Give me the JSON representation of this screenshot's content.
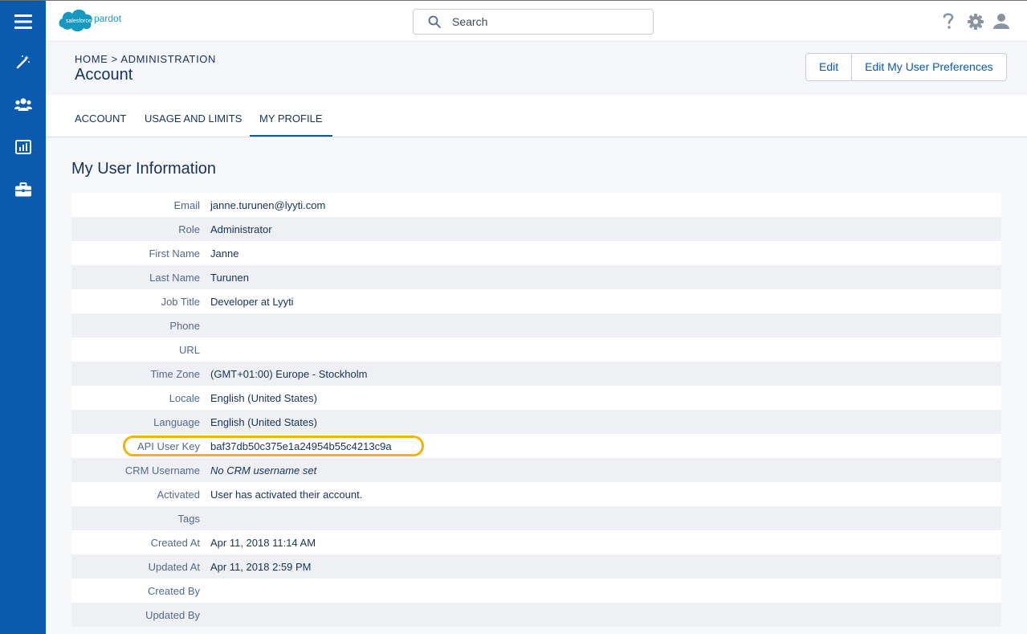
{
  "header": {
    "logo_brand": "salesforce",
    "logo_product": "pardot",
    "search_placeholder": "Search",
    "icons": [
      "help-icon",
      "gear-icon",
      "user-icon"
    ]
  },
  "nav": {
    "icons": [
      "menu-icon",
      "magic-wand-icon",
      "people-icon",
      "chart-icon",
      "briefcase-icon"
    ]
  },
  "breadcrumb": {
    "home": "HOME",
    "separator": ">",
    "admin": "ADMINISTRATION"
  },
  "page_title": "Account",
  "buttons": {
    "edit": "Edit",
    "edit_prefs": "Edit My User Preferences"
  },
  "tabs": [
    {
      "label": "ACCOUNT"
    },
    {
      "label": "USAGE AND LIMITS"
    },
    {
      "label": "MY PROFILE",
      "active": true
    }
  ],
  "section_title": "My User Information",
  "user_info": [
    {
      "label": "Email",
      "value": "janne.turunen@lyyti.com"
    },
    {
      "label": "Role",
      "value": "Administrator"
    },
    {
      "label": "First Name",
      "value": "Janne"
    },
    {
      "label": "Last Name",
      "value": "Turunen"
    },
    {
      "label": "Job Title",
      "value": "Developer at Lyyti"
    },
    {
      "label": "Phone",
      "value": ""
    },
    {
      "label": "URL",
      "value": ""
    },
    {
      "label": "Time Zone",
      "value": "(GMT+01:00) Europe - Stockholm"
    },
    {
      "label": "Locale",
      "value": "English (United States)"
    },
    {
      "label": "Language",
      "value": "English (United States)"
    },
    {
      "label": "API User Key",
      "value": "baf37db50c375e1a24954b55c4213c9a"
    },
    {
      "label": "CRM Username",
      "value": "No CRM username set"
    },
    {
      "label": "Activated",
      "value": "User has activated their account."
    },
    {
      "label": "Tags",
      "value": ""
    },
    {
      "label": "Created At",
      "value": "Apr 11, 2018 11:14 AM"
    },
    {
      "label": "Updated At",
      "value": "Apr 11, 2018 2:59 PM"
    },
    {
      "label": "Created By",
      "value": ""
    },
    {
      "label": "Updated By",
      "value": ""
    }
  ],
  "colors": {
    "nav_blue": "#0a5ab0",
    "text_navy": "#16325c",
    "highlight": "#f4b400"
  }
}
